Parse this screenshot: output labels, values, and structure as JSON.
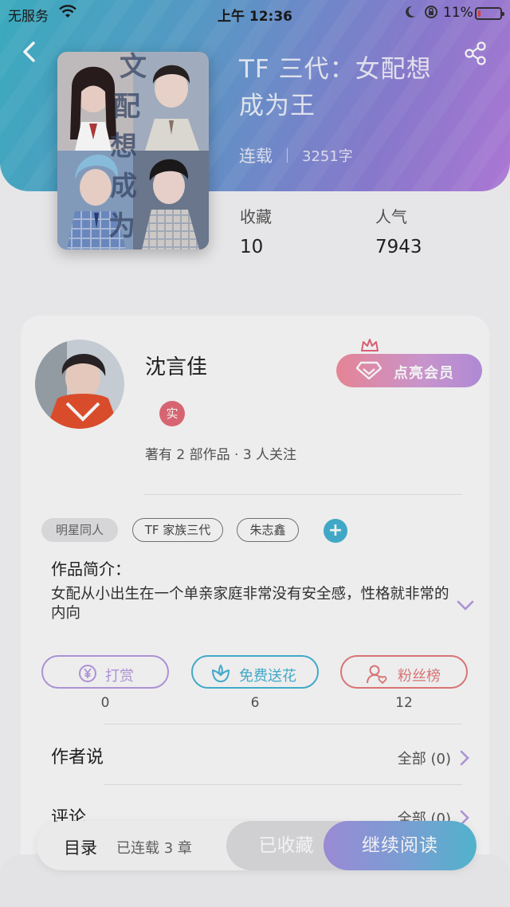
{
  "status_bar": {
    "carrier": "无服务",
    "time": "上午 12:36",
    "battery_pct": "11%",
    "battery_level": 0.11,
    "icons": [
      "wifi-icon",
      "moon-icon",
      "orientation-lock-icon",
      "battery-icon"
    ]
  },
  "header": {
    "back_icon": "chevron-left-icon",
    "share_icon": "share-icon",
    "gradient_colors": [
      "#3eb4c8",
      "#8f7fd6",
      "#b57ee0"
    ]
  },
  "book": {
    "title_line1": "TF 三代：女配想",
    "title_line2": "成为王",
    "status": "连载",
    "word_count": "3251字",
    "favorites_label": "收藏",
    "favorites": "10",
    "popularity_label": "人气",
    "popularity": "7943"
  },
  "author": {
    "name": "沈言佳",
    "badge": "实",
    "stats": "著有 2 部作品 · 3 人关注",
    "vip_button": "点亮会员"
  },
  "tags": {
    "items": [
      "明星同人",
      "TF 家族三代",
      "朱志鑫"
    ],
    "add_icon": "plus-icon"
  },
  "intro": {
    "title": "作品简介：",
    "text": "女配从小出生在一个单亲家庭非常没有安全感，性格就非常的内向"
  },
  "actions": [
    {
      "label": "打赏",
      "count": "0",
      "icon": "yen-coin-icon",
      "color": "#b69adf"
    },
    {
      "label": "免费送花",
      "count": "6",
      "icon": "flower-icon",
      "color": "#46b3d3"
    },
    {
      "label": "粉丝榜",
      "count": "12",
      "icon": "user-heart-icon",
      "color": "#e47b7b"
    }
  ],
  "sections": {
    "author_says": {
      "title": "作者说",
      "link": "全部 (0)"
    },
    "comments": {
      "title": "评论",
      "link": "全部 (0)"
    }
  },
  "bottom_bar": {
    "toc": "目录",
    "toc_status": "已连载 3 章",
    "collected": "已收藏",
    "continue": "继续阅读"
  }
}
